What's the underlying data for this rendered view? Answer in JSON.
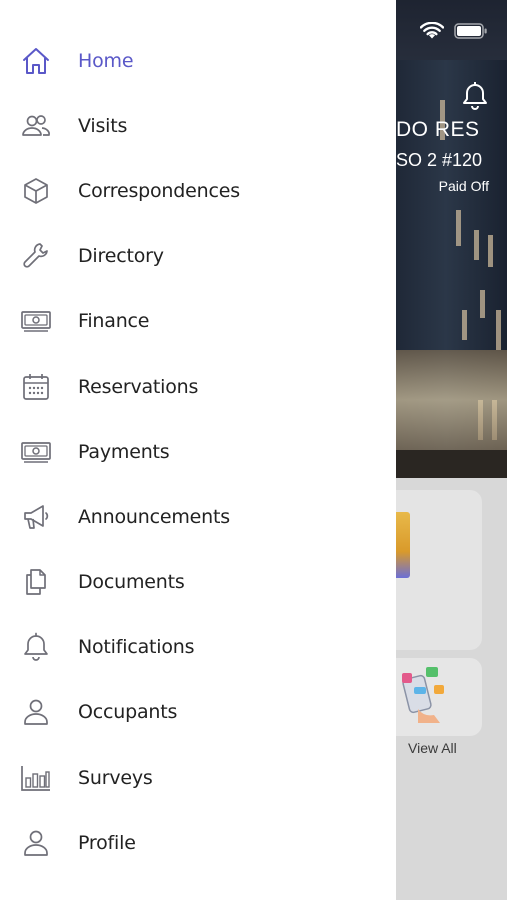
{
  "colors": {
    "accent": "#5a58c8",
    "icon_default": "#6f6f78",
    "text": "#222222",
    "drawer_bg": "#ffffff"
  },
  "background": {
    "title": "DO RES",
    "subtitle": "SO 2 #120",
    "status": "Paid Off",
    "view_all": "View All"
  },
  "menu": {
    "items": [
      {
        "label": "Home",
        "icon": "home-icon",
        "active": true
      },
      {
        "label": "Visits",
        "icon": "users-icon"
      },
      {
        "label": "Correspondences",
        "icon": "box-icon"
      },
      {
        "label": "Directory",
        "icon": "wrench-icon"
      },
      {
        "label": "Finance",
        "icon": "banknote-icon"
      },
      {
        "label": "Reservations",
        "icon": "calendar-icon"
      },
      {
        "label": "Payments",
        "icon": "banknote-icon"
      },
      {
        "label": "Announcements",
        "icon": "megaphone-icon"
      },
      {
        "label": "Documents",
        "icon": "documents-icon"
      },
      {
        "label": "Notifications",
        "icon": "bell-icon"
      },
      {
        "label": "Occupants",
        "icon": "user-icon"
      },
      {
        "label": "Surveys",
        "icon": "bar-chart-icon"
      },
      {
        "label": "Profile",
        "icon": "user-icon"
      }
    ]
  }
}
